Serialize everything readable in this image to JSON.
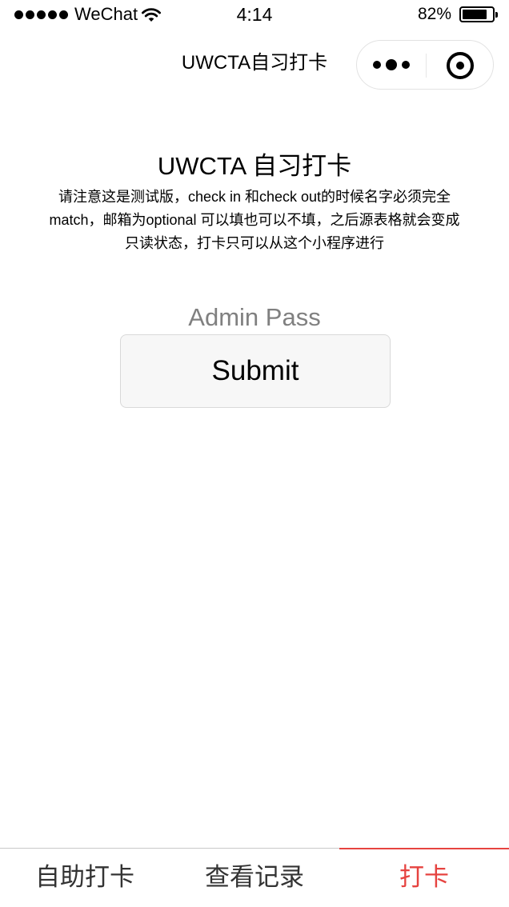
{
  "status_bar": {
    "carrier": "WeChat",
    "time": "4:14",
    "battery_percent_label": "82%",
    "battery_level": 0.82
  },
  "nav": {
    "title": "UWCTA自习打卡"
  },
  "main": {
    "title": "UWCTA 自习打卡",
    "notice": "请注意这是测试版，check in 和check out的时候名字必须完全match，邮箱为optional 可以填也可以不填，之后源表格就会变成只读状态，打卡只可以从这个小程序进行",
    "admin_placeholder": "Admin Pass",
    "submit_label": "Submit"
  },
  "tabbar": {
    "tabs": [
      {
        "label": "自助打卡",
        "active": false
      },
      {
        "label": "查看记录",
        "active": false
      },
      {
        "label": "打卡",
        "active": true
      }
    ],
    "active_color": "#e64340"
  }
}
